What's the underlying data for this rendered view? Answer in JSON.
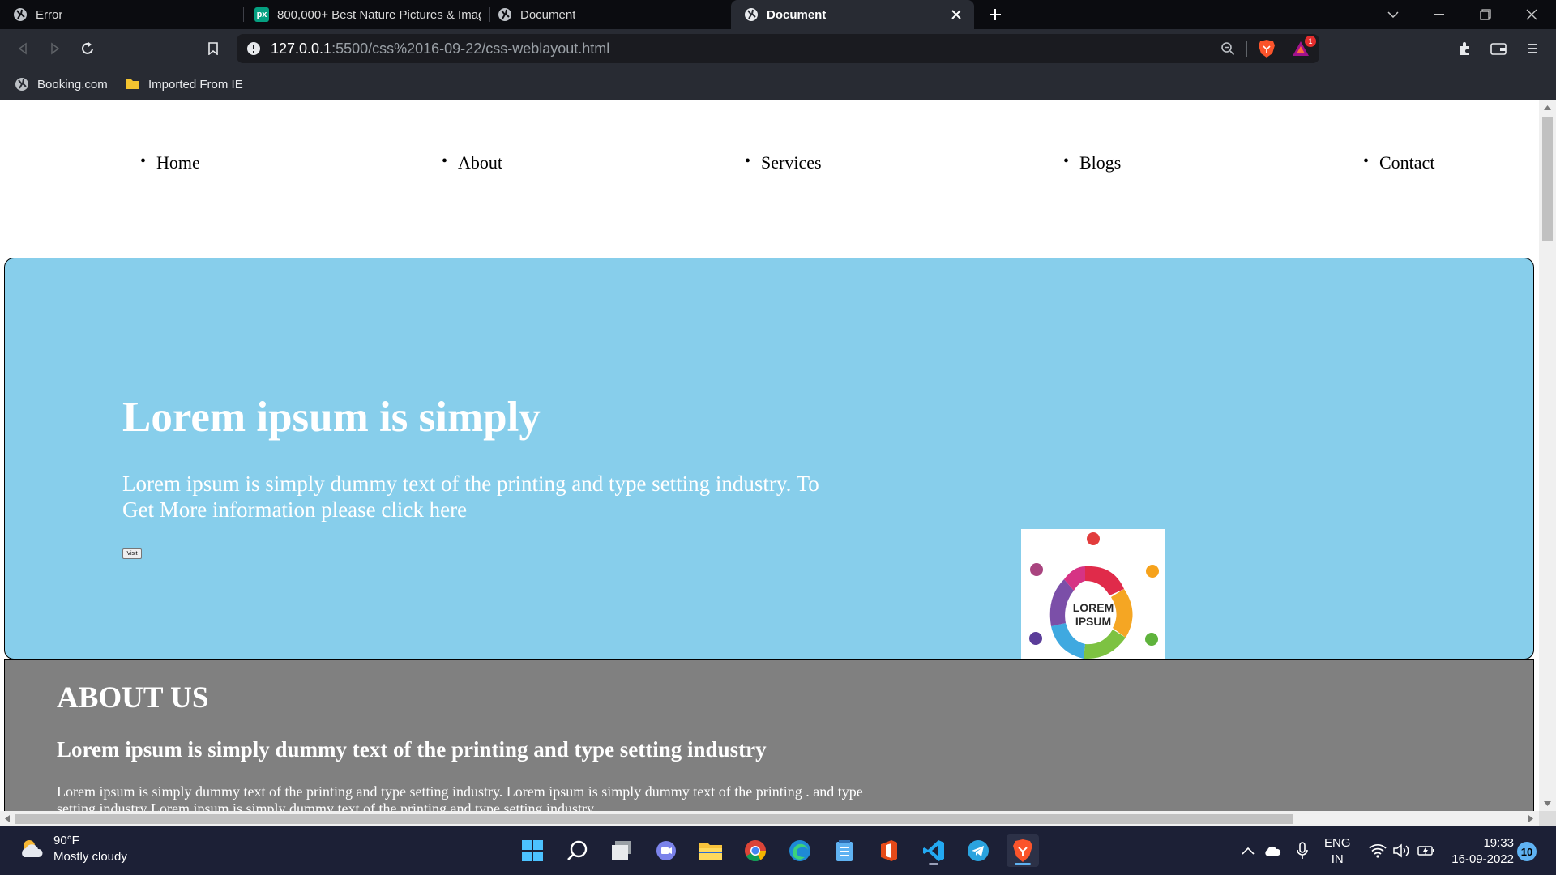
{
  "browser": {
    "tabs": [
      {
        "title": "Error",
        "active": false,
        "favicon": "globe-icon"
      },
      {
        "title": "800,000+ Best Nature Pictures & Imag",
        "active": false,
        "favicon": "pexels-icon",
        "favicon_text": "px"
      },
      {
        "title": "Document",
        "active": false,
        "favicon": "globe-icon"
      },
      {
        "title": "Document",
        "active": true,
        "favicon": "globe-icon"
      }
    ],
    "address": {
      "host": "127.0.0.1",
      "path": ":5500/css%2016-09-22/css-weblayout.html"
    },
    "brave_badge": "1",
    "bookmarks": [
      {
        "label": "Booking.com",
        "icon": "globe-icon"
      },
      {
        "label": "Imported From IE",
        "icon": "folder-icon"
      }
    ]
  },
  "page": {
    "nav": [
      "Home",
      "About",
      "Services",
      "Blogs",
      "Contact"
    ],
    "hero": {
      "title": "Lorem ipsum is simply",
      "text": "Lorem ipsum is simply dummy text of the printing and type setting industry. To Get More information please click here",
      "button": "Visit",
      "logo_text_1": "LOREM",
      "logo_text_2": "IPSUM"
    },
    "about": {
      "title": "ABOUT US",
      "subtitle": "Lorem ipsum is simply dummy text of the printing and type setting industry",
      "text": "Lorem ipsum is simply dummy text of the printing and type setting industry. Lorem ipsum is simply dummy text of the printing . and type setting industry Lorem ipsum is simply dummy text of the printing and type setting industry."
    }
  },
  "taskbar": {
    "weather_temp": "90°F",
    "weather_desc": "Mostly cloudy",
    "lang_1": "ENG",
    "lang_2": "IN",
    "time": "19:33",
    "date": "16-09-2022",
    "notifications": "10"
  },
  "colors": {
    "hero_bg": "#87ceeb",
    "about_bg": "#808080",
    "taskbar_bg": "#1c2036",
    "tabstrip_bg": "#0b0c10",
    "toolbar_bg": "#282b33"
  }
}
